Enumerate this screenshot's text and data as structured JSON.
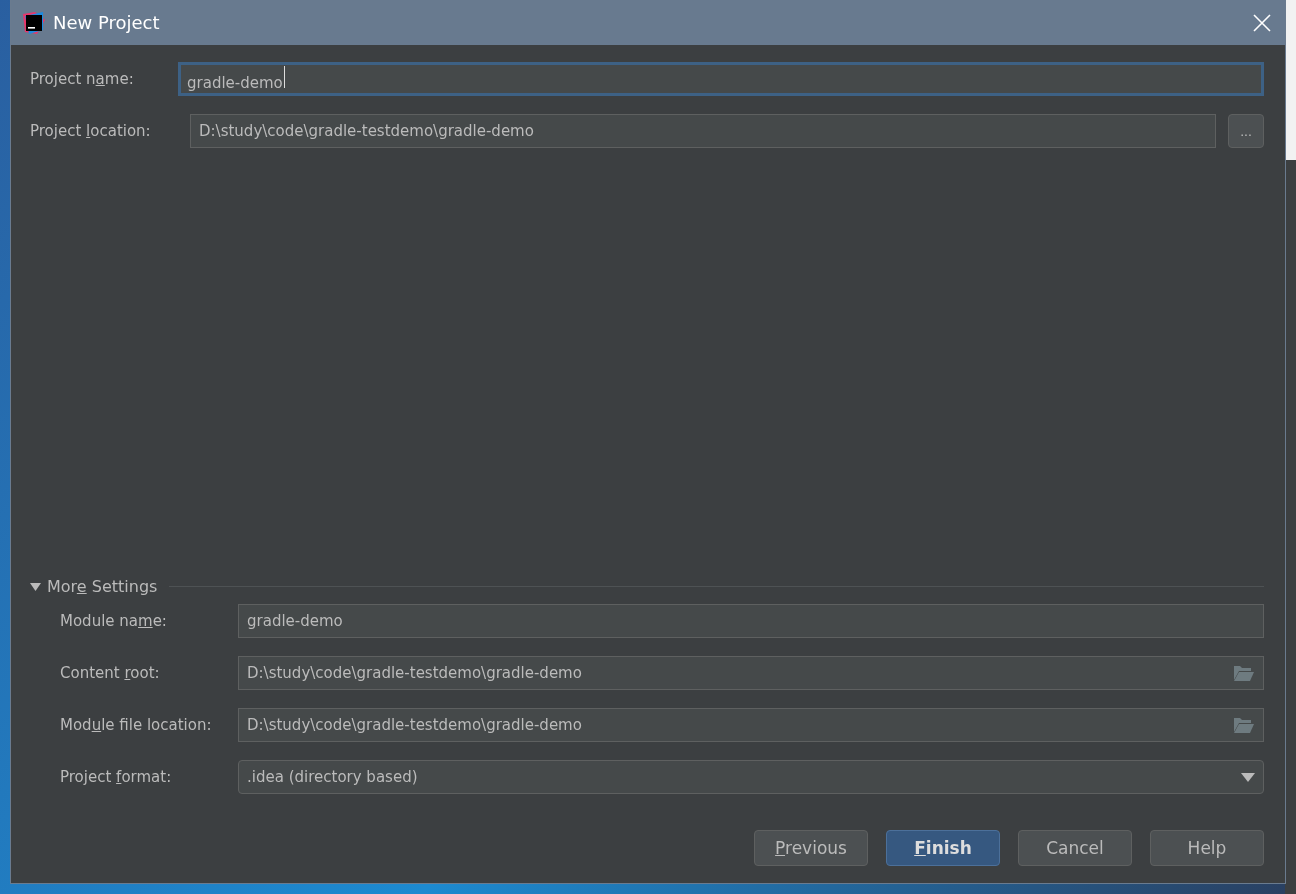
{
  "window": {
    "title": "New Project"
  },
  "fields": [
    {
      "label": {
        "before": "Project n",
        "key": "a",
        "after": "me:"
      },
      "value": "gradle-demo",
      "focused": true,
      "kind": "text"
    },
    {
      "label": {
        "before": "Project ",
        "key": "l",
        "after": "ocation:"
      },
      "value": "D:\\study\\code\\gradle-testdemo\\gradle-demo",
      "focused": false,
      "kind": "browse",
      "browse_label": "..."
    }
  ],
  "more_settings": {
    "label": {
      "before": "Mor",
      "key": "e",
      "after": " Settings"
    },
    "expanded": true,
    "fields": [
      {
        "label": {
          "before": "Module na",
          "key": "m",
          "after": "e:"
        },
        "value": "gradle-demo",
        "kind": "text"
      },
      {
        "label": {
          "before": "Content ",
          "key": "r",
          "after": "oot:"
        },
        "value": "D:\\study\\code\\gradle-testdemo\\gradle-demo",
        "kind": "folder"
      },
      {
        "label": {
          "before": "Mod",
          "key": "u",
          "after": "le file location:"
        },
        "value": "D:\\study\\code\\gradle-testdemo\\gradle-demo",
        "kind": "folder"
      },
      {
        "label": {
          "before": "Project ",
          "key": "f",
          "after": "ormat:"
        },
        "value": ".idea (directory based)",
        "kind": "dropdown"
      }
    ]
  },
  "buttons": [
    {
      "label": {
        "key": "P",
        "after": "revious"
      },
      "default": false
    },
    {
      "label": {
        "key": "F",
        "after": "inish"
      },
      "default": true
    },
    {
      "label": {
        "before": "Cancel"
      },
      "default": false
    },
    {
      "label": {
        "before": "Help"
      },
      "default": false
    }
  ]
}
